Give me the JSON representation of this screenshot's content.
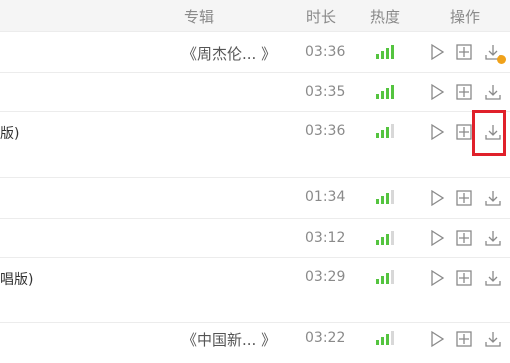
{
  "header": {
    "album": "专辑",
    "duration": "时长",
    "heat": "热度",
    "actions": "操作"
  },
  "rows": [
    {
      "title": "",
      "album": "《周杰伦...  》",
      "duration": "03:36",
      "heat": 4
    },
    {
      "title": "",
      "album": "",
      "duration": "03:35",
      "heat": 4
    },
    {
      "title": "版)",
      "album": "",
      "duration": "03:36",
      "heat": 3
    },
    {
      "title": "",
      "album": "",
      "duration": "01:34",
      "heat": 3
    },
    {
      "title": "",
      "album": "",
      "duration": "03:12",
      "heat": 3
    },
    {
      "title": "唱版)",
      "album": "",
      "duration": "03:29",
      "heat": 3
    },
    {
      "title": "",
      "album": "《中国新...  》",
      "duration": "03:22",
      "heat": 3
    }
  ],
  "icons": {
    "play": "play-icon",
    "add": "add-to-playlist-icon",
    "download": "download-icon",
    "coin_badge": "paid-coin-icon"
  },
  "colors": {
    "heat_on": "#54c43f",
    "heat_off": "#d8d8d8",
    "highlight": "#e0202a",
    "coin": "#f0a21a"
  }
}
